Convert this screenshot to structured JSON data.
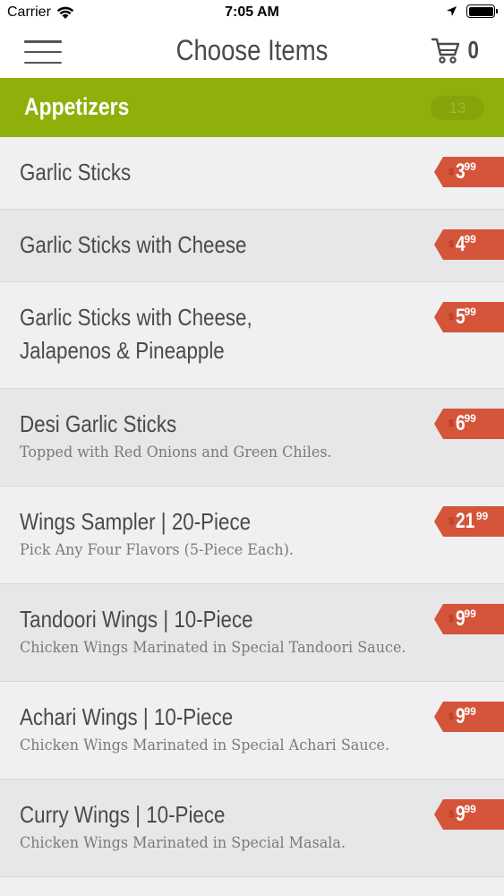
{
  "status": {
    "carrier": "Carrier",
    "time": "7:05 AM"
  },
  "nav": {
    "title": "Choose Items",
    "cart_count": "0"
  },
  "category": {
    "title": "Appetizers",
    "count": "13"
  },
  "items": [
    {
      "name": "Garlic Sticks",
      "desc": "",
      "dollar": "$",
      "price": "3",
      "cents": "99"
    },
    {
      "name": "Garlic Sticks with Cheese",
      "desc": "",
      "dollar": "$",
      "price": "4",
      "cents": "99"
    },
    {
      "name": "Garlic Sticks with Cheese,",
      "name2": "Jalapenos & Pineapple",
      "desc": "",
      "dollar": "$",
      "price": "5",
      "cents": "99"
    },
    {
      "name": "Desi Garlic Sticks",
      "desc": "Topped with Red Onions and Green Chiles.",
      "dollar": "$",
      "price": "6",
      "cents": "99"
    },
    {
      "name": "Wings Sampler | 20-Piece",
      "desc": "Pick Any Four Flavors (5-Piece Each).",
      "dollar": "$",
      "price": "21",
      "cents": "99"
    },
    {
      "name": "Tandoori Wings | 10-Piece",
      "desc": "Chicken Wings Marinated in Special Tandoori Sauce.",
      "dollar": "$",
      "price": "9",
      "cents": "99"
    },
    {
      "name": "Achari Wings | 10-Piece",
      "desc": "Chicken Wings Marinated in Special Achari Sauce.",
      "dollar": "$",
      "price": "9",
      "cents": "99"
    },
    {
      "name": "Curry Wings | 10-Piece",
      "desc": "Chicken Wings Marinated in Special Masala.",
      "dollar": "$",
      "price": "9",
      "cents": "99"
    }
  ]
}
